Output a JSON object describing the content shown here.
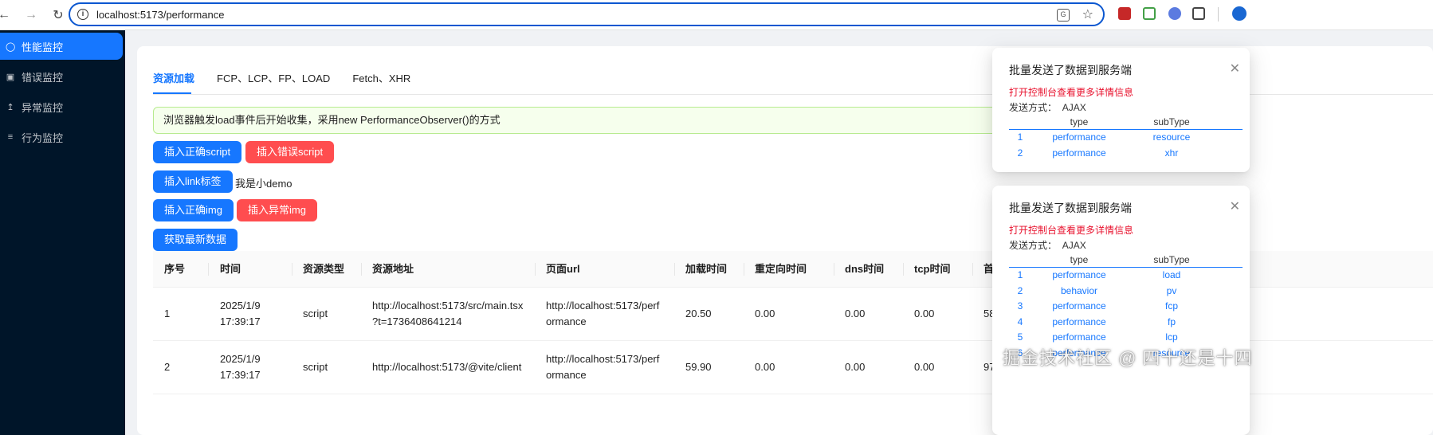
{
  "browser": {
    "url": "localhost:5173/performance",
    "back_icon": "arrow-left-icon",
    "forward_icon": "arrow-right-icon",
    "reload_icon": "reload-icon"
  },
  "sidebar": {
    "items": [
      {
        "label": "性能监控",
        "icon": "user-icon",
        "active": true
      },
      {
        "label": "错误监控",
        "icon": "video-icon",
        "active": false
      },
      {
        "label": "异常监控",
        "icon": "upload-icon",
        "active": false
      },
      {
        "label": "行为监控",
        "icon": "list-icon",
        "active": false
      }
    ]
  },
  "tabs": [
    "资源加载",
    "FCP、LCP、FP、LOAD",
    "Fetch、XHR"
  ],
  "alert": "浏览器触发load事件后开始收集，采用new PerformanceObserver()的方式",
  "buttons": {
    "insert_script_ok": "插入正确script",
    "insert_script_err": "插入错误script",
    "insert_link": "插入link标签",
    "demo_text": "我是小demo",
    "insert_img_ok": "插入正确img",
    "insert_img_err": "插入异常img",
    "fetch_latest": "获取最新数据"
  },
  "table": {
    "columns": [
      "序号",
      "时间",
      "资源类型",
      "资源地址",
      "页面url",
      "加载时间",
      "重定向时间",
      "dns时间",
      "tcp时间",
      "首"
    ],
    "rows": [
      {
        "index": "1",
        "time_line1": "2025/1/9",
        "time_line2": "17:39:17",
        "type": "script",
        "src_line1": "http://localhost:5173/src/main.tsx",
        "src_line2": "?t=1736408641214",
        "page_line1": "http://localhost:5173/perf",
        "page_line2": "ormance",
        "load": "20.50",
        "redirect": "0.00",
        "dns": "0.00",
        "tcp": "0.00",
        "first": "58"
      },
      {
        "index": "2",
        "time_line1": "2025/1/9",
        "time_line2": "17:39:17",
        "type": "script",
        "src_line1": "http://localhost:5173/@vite/client",
        "src_line2": "",
        "page_line1": "http://localhost:5173/perf",
        "page_line2": "ormance",
        "load": "59.90",
        "redirect": "0.00",
        "dns": "0.00",
        "tcp": "0.00",
        "first": "97"
      }
    ]
  },
  "notifications": [
    {
      "title": "批量发送了数据到服务端",
      "link": "打开控制台查看更多详情信息",
      "method_label": "发送方式：",
      "method_value": "AJAX",
      "head": {
        "type": "type",
        "subtype": "subType"
      },
      "rows": [
        {
          "i": "1",
          "type": "performance",
          "subtype": "resource"
        },
        {
          "i": "2",
          "type": "performance",
          "subtype": "xhr"
        }
      ]
    },
    {
      "title": "批量发送了数据到服务端",
      "link": "打开控制台查看更多详情信息",
      "method_label": "发送方式：",
      "method_value": "AJAX",
      "head": {
        "type": "type",
        "subtype": "subType"
      },
      "rows": [
        {
          "i": "1",
          "type": "performance",
          "subtype": "load"
        },
        {
          "i": "2",
          "type": "behavior",
          "subtype": "pv"
        },
        {
          "i": "3",
          "type": "performance",
          "subtype": "fcp"
        },
        {
          "i": "4",
          "type": "performance",
          "subtype": "fp"
        },
        {
          "i": "5",
          "type": "performance",
          "subtype": "lcp"
        },
        {
          "i": "6",
          "type": "performance",
          "subtype": "resource"
        }
      ]
    }
  ],
  "watermark": "掘金技术社区 @ 四十还是十四",
  "colors": {
    "primary": "#1677ff",
    "danger": "#ff4d4f",
    "sidebar": "#001529",
    "link_red": "#e8112d"
  }
}
